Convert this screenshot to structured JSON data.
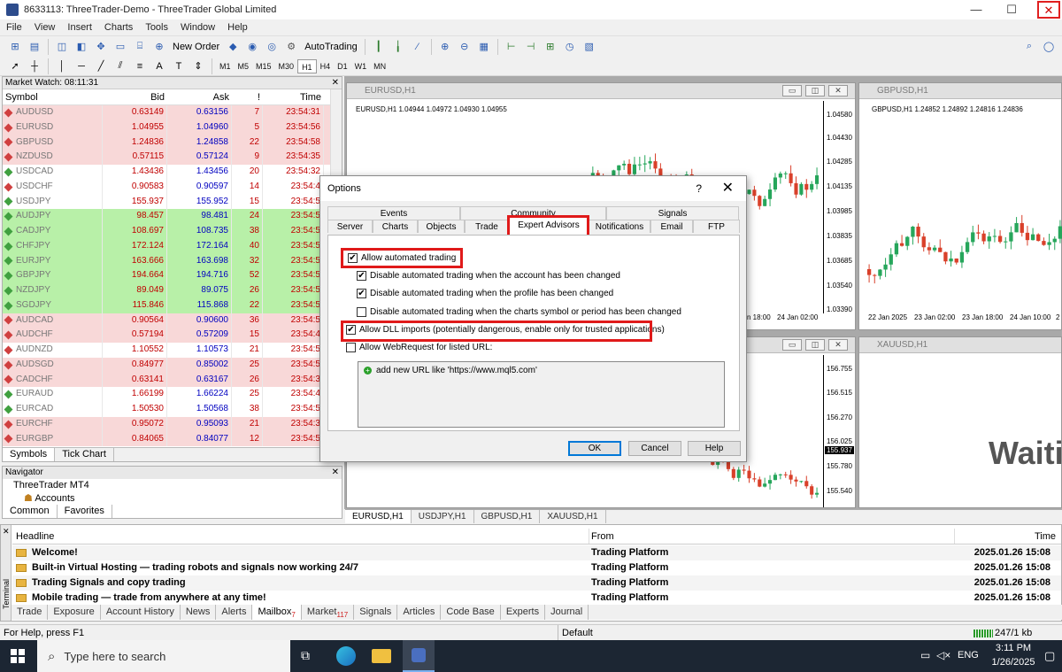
{
  "window": {
    "title": "8633113: ThreeTrader-Demo - ThreeTrader Global Limited",
    "min": "—",
    "max": "☐",
    "close": "✕"
  },
  "menu": [
    "File",
    "View",
    "Insert",
    "Charts",
    "Tools",
    "Window",
    "Help"
  ],
  "toolbar": {
    "new_order": "New Order",
    "autotrading": "AutoTrading"
  },
  "timeframes": [
    "M1",
    "M5",
    "M15",
    "M30",
    "H1",
    "H4",
    "D1",
    "W1",
    "MN"
  ],
  "market_watch": {
    "title": "Market Watch: 08:11:31",
    "columns": [
      "Symbol",
      "Bid",
      "Ask",
      "!",
      "Time"
    ],
    "rows": [
      {
        "symbol": "AUDUSD",
        "bid": "0.63149",
        "ask": "0.63156",
        "spread": "7",
        "time": "23:54:31",
        "bg": "#f8d8d8",
        "arrow": "#d04040"
      },
      {
        "symbol": "EURUSD",
        "bid": "1.04955",
        "ask": "1.04960",
        "spread": "5",
        "time": "23:54:56",
        "bg": "#f8d8d8",
        "arrow": "#d04040"
      },
      {
        "symbol": "GBPUSD",
        "bid": "1.24836",
        "ask": "1.24858",
        "spread": "22",
        "time": "23:54:58",
        "bg": "#f8d8d8",
        "arrow": "#d04040"
      },
      {
        "symbol": "NZDUSD",
        "bid": "0.57115",
        "ask": "0.57124",
        "spread": "9",
        "time": "23:54:35",
        "bg": "#f8d8d8",
        "arrow": "#d04040"
      },
      {
        "symbol": "USDCAD",
        "bid": "1.43436",
        "ask": "1.43456",
        "spread": "20",
        "time": "23:54:32",
        "bg": "#ffffff",
        "arrow": "#40a040"
      },
      {
        "symbol": "USDCHF",
        "bid": "0.90583",
        "ask": "0.90597",
        "spread": "14",
        "time": "23:54:4",
        "bg": "#ffffff",
        "arrow": "#d04040"
      },
      {
        "symbol": "USDJPY",
        "bid": "155.937",
        "ask": "155.952",
        "spread": "15",
        "time": "23:54:5",
        "bg": "#ffffff",
        "arrow": "#40a040"
      },
      {
        "symbol": "AUDJPY",
        "bid": "98.457",
        "ask": "98.481",
        "spread": "24",
        "time": "23:54:5",
        "bg": "#b8f0a8",
        "arrow": "#40a040"
      },
      {
        "symbol": "CADJPY",
        "bid": "108.697",
        "ask": "108.735",
        "spread": "38",
        "time": "23:54:5",
        "bg": "#b8f0a8",
        "arrow": "#40a040"
      },
      {
        "symbol": "CHFJPY",
        "bid": "172.124",
        "ask": "172.164",
        "spread": "40",
        "time": "23:54:5",
        "bg": "#b8f0a8",
        "arrow": "#40a040"
      },
      {
        "symbol": "EURJPY",
        "bid": "163.666",
        "ask": "163.698",
        "spread": "32",
        "time": "23:54:5",
        "bg": "#b8f0a8",
        "arrow": "#40a040"
      },
      {
        "symbol": "GBPJPY",
        "bid": "194.664",
        "ask": "194.716",
        "spread": "52",
        "time": "23:54:5",
        "bg": "#b8f0a8",
        "arrow": "#40a040"
      },
      {
        "symbol": "NZDJPY",
        "bid": "89.049",
        "ask": "89.075",
        "spread": "26",
        "time": "23:54:5",
        "bg": "#b8f0a8",
        "arrow": "#40a040"
      },
      {
        "symbol": "SGDJPY",
        "bid": "115.846",
        "ask": "115.868",
        "spread": "22",
        "time": "23:54:5",
        "bg": "#b8f0a8",
        "arrow": "#40a040"
      },
      {
        "symbol": "AUDCAD",
        "bid": "0.90564",
        "ask": "0.90600",
        "spread": "36",
        "time": "23:54:5",
        "bg": "#f8d8d8",
        "arrow": "#d04040"
      },
      {
        "symbol": "AUDCHF",
        "bid": "0.57194",
        "ask": "0.57209",
        "spread": "15",
        "time": "23:54:4",
        "bg": "#f8d8d8",
        "arrow": "#d04040"
      },
      {
        "symbol": "AUDNZD",
        "bid": "1.10552",
        "ask": "1.10573",
        "spread": "21",
        "time": "23:54:5",
        "bg": "#ffffff",
        "arrow": "#d04040"
      },
      {
        "symbol": "AUDSGD",
        "bid": "0.84977",
        "ask": "0.85002",
        "spread": "25",
        "time": "23:54:5",
        "bg": "#f8d8d8",
        "arrow": "#d04040"
      },
      {
        "symbol": "CADCHF",
        "bid": "0.63141",
        "ask": "0.63167",
        "spread": "26",
        "time": "23:54:3",
        "bg": "#f8d8d8",
        "arrow": "#d04040"
      },
      {
        "symbol": "EURAUD",
        "bid": "1.66199",
        "ask": "1.66224",
        "spread": "25",
        "time": "23:54:4",
        "bg": "#ffffff",
        "arrow": "#40a040"
      },
      {
        "symbol": "EURCAD",
        "bid": "1.50530",
        "ask": "1.50568",
        "spread": "38",
        "time": "23:54:5",
        "bg": "#ffffff",
        "arrow": "#40a040"
      },
      {
        "symbol": "EURCHF",
        "bid": "0.95072",
        "ask": "0.95093",
        "spread": "21",
        "time": "23:54:3",
        "bg": "#f8d8d8",
        "arrow": "#d04040"
      },
      {
        "symbol": "EURGBP",
        "bid": "0.84065",
        "ask": "0.84077",
        "spread": "12",
        "time": "23:54:5",
        "bg": "#f8d8d8",
        "arrow": "#d04040"
      }
    ],
    "tabs": [
      "Symbols",
      "Tick Chart"
    ]
  },
  "navigator": {
    "title": "Navigator",
    "item1": "ThreeTrader MT4",
    "item2": "Accounts",
    "tabs": [
      "Common",
      "Favorites"
    ]
  },
  "charts": {
    "eurusd": {
      "title": "EURUSD,H1",
      "ohlc": "EURUSD,H1  1.04944 1.04972 1.04930 1.04955",
      "yticks": [
        "1.04580",
        "1.04430",
        "1.04285",
        "1.04135",
        "1.03985",
        "1.03835",
        "1.03685",
        "1.03540",
        "1.03390"
      ]
    },
    "gbpusd": {
      "title": "GBPUSD,H1",
      "ohlc": "GBPUSD,H1  1.24852 1.24892 1.24816 1.24836",
      "xticks": [
        "22 Jan 2025",
        "23 Jan 02:00",
        "23 Jan 18:00",
        "24 Jan 10:00",
        "2"
      ]
    },
    "usdjpy": {
      "yticks": [
        "156.755",
        "156.515",
        "156.270",
        "156.025",
        "155.937",
        "155.780",
        "155.540"
      ]
    },
    "eurusd_xticks": [
      "n 18:00",
      "24 Jan 02:00"
    ],
    "xauusd": {
      "title": "XAUUSD,H1",
      "waiting": "Waiti"
    },
    "tabs": [
      "EURUSD,H1",
      "USDJPY,H1",
      "GBPUSD,H1",
      "XAUUSD,H1"
    ]
  },
  "terminal": {
    "label": "Terminal",
    "columns": [
      "Headline",
      "From",
      "Time"
    ],
    "rows": [
      {
        "headline": "Welcome!",
        "from": "Trading Platform",
        "time": "2025.01.26 15:08"
      },
      {
        "headline": "Built-in Virtual Hosting — trading robots and signals now working 24/7",
        "from": "Trading Platform",
        "time": "2025.01.26 15:08"
      },
      {
        "headline": "Trading Signals and copy trading",
        "from": "Trading Platform",
        "time": "2025.01.26 15:08"
      },
      {
        "headline": "Mobile trading — trade from anywhere at any time!",
        "from": "Trading Platform",
        "time": "2025.01.26 15:08"
      }
    ],
    "tabs": [
      {
        "label": "Trade",
        "sub": ""
      },
      {
        "label": "Exposure",
        "sub": ""
      },
      {
        "label": "Account History",
        "sub": ""
      },
      {
        "label": "News",
        "sub": ""
      },
      {
        "label": "Alerts",
        "sub": ""
      },
      {
        "label": "Mailbox",
        "sub": "7"
      },
      {
        "label": "Market",
        "sub": "117"
      },
      {
        "label": "Signals",
        "sub": ""
      },
      {
        "label": "Articles",
        "sub": ""
      },
      {
        "label": "Code Base",
        "sub": ""
      },
      {
        "label": "Experts",
        "sub": ""
      },
      {
        "label": "Journal",
        "sub": ""
      }
    ]
  },
  "status": {
    "help": "For Help, press F1",
    "profile": "Default",
    "traffic": "247/1 kb"
  },
  "taskbar": {
    "search": "Type here to search",
    "lang": "ENG",
    "time": "3:11 PM",
    "date": "1/26/2025"
  },
  "dialog": {
    "title": "Options",
    "help": "?",
    "close": "✕",
    "tabs_top": [
      "Events",
      "Community",
      "Signals"
    ],
    "tabs_bottom": [
      "Server",
      "Charts",
      "Objects",
      "Trade",
      "Expert Advisors",
      "Notifications",
      "Email",
      "FTP"
    ],
    "options": [
      {
        "label": "Allow automated trading",
        "checked": true
      },
      {
        "label": "Disable automated trading when the account has been changed",
        "checked": true
      },
      {
        "label": "Disable automated trading when the profile has been changed",
        "checked": true
      },
      {
        "label": "Disable automated trading when the charts symbol or period has been changed",
        "checked": false
      },
      {
        "label": "Allow DLL imports (potentially dangerous, enable only for trusted applications)",
        "checked": true
      },
      {
        "label": "Allow WebRequest for listed URL:",
        "checked": false
      }
    ],
    "url_placeholder": "add new URL like 'https://www.mql5.com'",
    "ok": "OK",
    "cancel": "Cancel",
    "help_btn": "Help"
  },
  "colors": {
    "highlight": "#e01a1a",
    "bull": "#26a65b",
    "bear": "#d9402a"
  }
}
